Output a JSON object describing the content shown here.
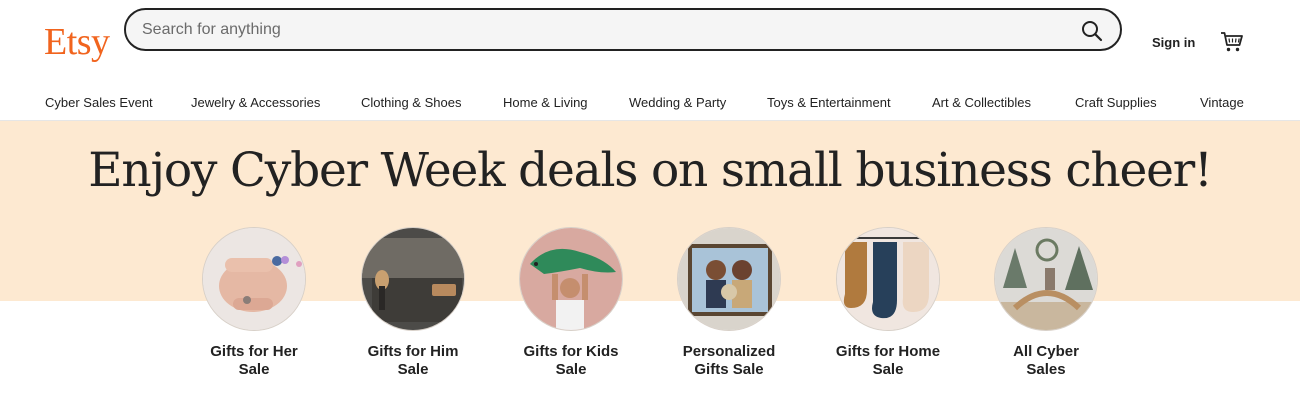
{
  "header": {
    "logo": "Etsy",
    "search_placeholder": "Search for anything",
    "search_icon": "search-icon",
    "signin_label": "Sign in",
    "cart_icon": "cart-icon"
  },
  "nav": {
    "items": [
      "Cyber Sales Event",
      "Jewelry & Accessories",
      "Clothing & Shoes",
      "Home & Living",
      "Wedding & Party",
      "Toys & Entertainment",
      "Art & Collectibles",
      "Craft Supplies",
      "Vintage"
    ]
  },
  "hero": {
    "headline": "Enjoy Cyber Week deals on small business cheer!",
    "categories": [
      {
        "label": "Gifts for Her\nSale",
        "image": "hand-rings-photo"
      },
      {
        "label": "Gifts for Him\nSale",
        "image": "grooming-kit-photo"
      },
      {
        "label": "Gifts for Kids\nSale",
        "image": "child-dinosaur-photo"
      },
      {
        "label": "Personalized\nGifts Sale",
        "image": "family-portrait-photo"
      },
      {
        "label": "Gifts for Home\nSale",
        "image": "stockings-photo"
      },
      {
        "label": "All Cyber\nSales",
        "image": "holiday-decor-photo"
      }
    ]
  },
  "colors": {
    "brand": "#f1641e",
    "band": "#fde9d1",
    "text": "#222222"
  }
}
